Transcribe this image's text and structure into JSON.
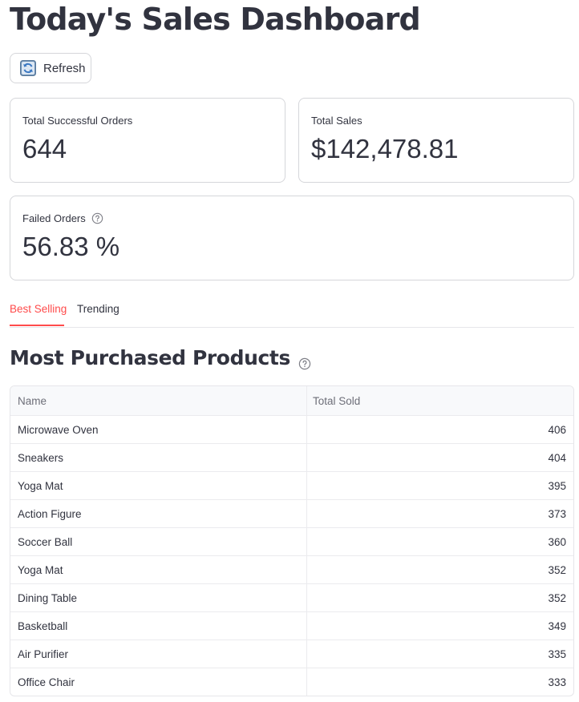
{
  "header": {
    "title": "Today's Sales Dashboard",
    "refresh_label": "Refresh"
  },
  "metrics": {
    "successful_orders": {
      "label": "Total Successful Orders",
      "value": "644"
    },
    "total_sales": {
      "label": "Total Sales",
      "value": "$142,478.81"
    },
    "failed_orders": {
      "label": "Failed Orders",
      "value": "56.83 %"
    }
  },
  "tabs": [
    {
      "label": "Best Selling",
      "active": true
    },
    {
      "label": "Trending",
      "active": false
    }
  ],
  "section": {
    "title": "Most Purchased Products"
  },
  "table": {
    "columns": [
      "Name",
      "Total Sold"
    ],
    "rows": [
      [
        "Microwave Oven",
        "406"
      ],
      [
        "Sneakers",
        "404"
      ],
      [
        "Yoga Mat",
        "395"
      ],
      [
        "Action Figure",
        "373"
      ],
      [
        "Soccer Ball",
        "360"
      ],
      [
        "Yoga Mat",
        "352"
      ],
      [
        "Dining Table",
        "352"
      ],
      [
        "Basketball",
        "349"
      ],
      [
        "Air Purifier",
        "335"
      ],
      [
        "Office Chair",
        "333"
      ]
    ]
  },
  "colors": {
    "accent": "#ff4b4b",
    "text": "#31333f",
    "border": "#d5d6da"
  },
  "icons": {
    "refresh": "refresh-icon",
    "help": "question-circle-icon"
  }
}
